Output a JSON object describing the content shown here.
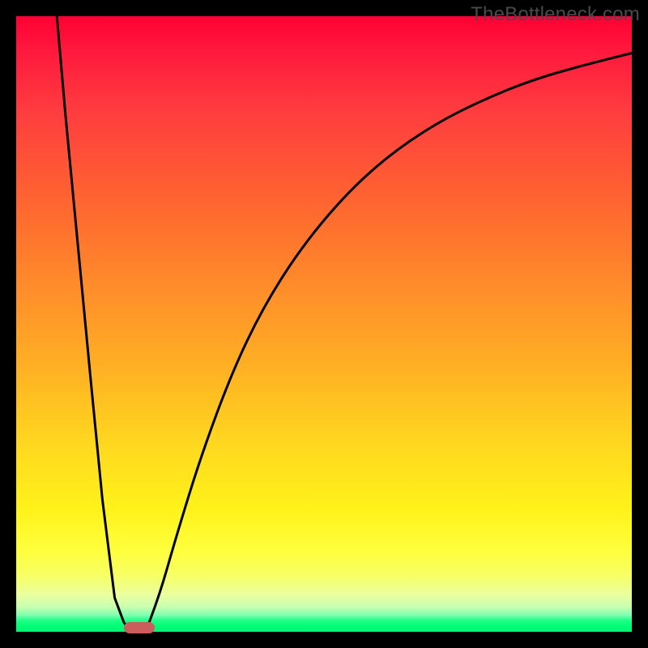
{
  "watermark": "TheBottleneck.com",
  "chart_data": {
    "type": "line",
    "title": "",
    "xlabel": "",
    "ylabel": "",
    "xlim": [
      0,
      100
    ],
    "ylim": [
      0,
      100
    ],
    "grid": false,
    "legend": null,
    "background_gradient": {
      "direction": "vertical",
      "stops": [
        {
          "pos": 0.0,
          "color": "#ff0033"
        },
        {
          "pos": 0.32,
          "color": "#ff6a2f"
        },
        {
          "pos": 0.58,
          "color": "#ffb323"
        },
        {
          "pos": 0.8,
          "color": "#fff21a"
        },
        {
          "pos": 0.94,
          "color": "#eaffa0"
        },
        {
          "pos": 0.985,
          "color": "#22ff88"
        },
        {
          "pos": 1.0,
          "color": "#00f472"
        }
      ]
    },
    "series": [
      {
        "name": "left-branch",
        "x": [
          6.6,
          8.0,
          10.0,
          12.0,
          14.0,
          16.0,
          17.5,
          18.5,
          19.0
        ],
        "y": [
          100.0,
          84.0,
          63.0,
          42.0,
          21.5,
          5.5,
          1.5,
          0.3,
          0.0
        ]
      },
      {
        "name": "right-branch",
        "x": [
          21.0,
          23.0,
          26.0,
          30.0,
          35.0,
          40.0,
          46.0,
          53.0,
          60.0,
          68.0,
          76.0,
          84.0,
          92.0,
          100.0
        ],
        "y": [
          0.0,
          5.0,
          15.5,
          28.5,
          42.0,
          52.5,
          62.0,
          70.5,
          77.0,
          82.5,
          86.5,
          89.7,
          92.0,
          94.0
        ]
      }
    ],
    "marker": {
      "name": "optimal-point",
      "x": 20.0,
      "y": 0.0,
      "color": "#cd5c5c",
      "shape": "pill"
    }
  },
  "colors": {
    "frame": "#000000",
    "curve": "#000000",
    "marker": "#cd5c5c",
    "watermark": "#4a4a4a"
  }
}
